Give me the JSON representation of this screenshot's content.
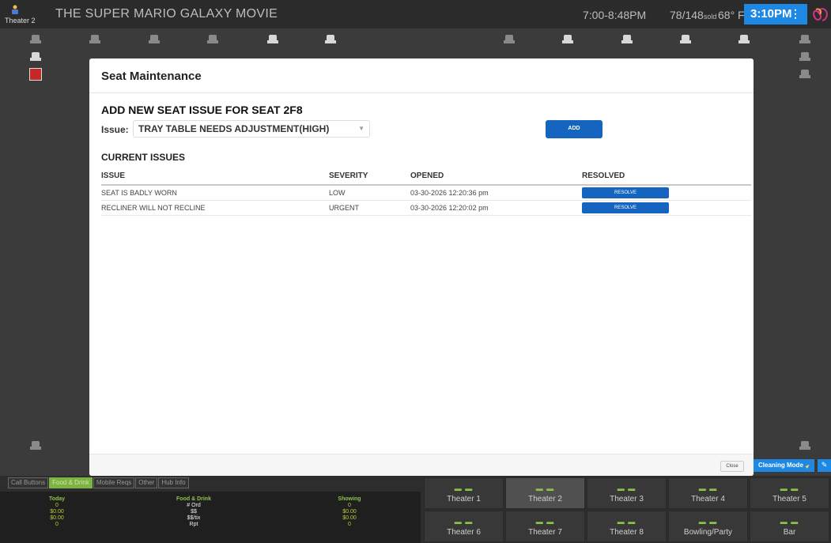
{
  "topbar": {
    "theater_label": "Theater 2",
    "movie_title": "THE SUPER MARIO GALAXY MOVIE",
    "showtime": "7:00-8:48PM",
    "sold_count": "78/148",
    "sold_suffix": "sold",
    "temperature": "68° F",
    "clock": "3:10PM",
    "kebab_icon": "⋮"
  },
  "seatmap": {
    "cleaning_mode_label": "Cleaning Mode",
    "wrench_icon": "✎"
  },
  "modal": {
    "title": "Seat Maintenance",
    "add_title": "ADD NEW SEAT ISSUE FOR SEAT 2F8",
    "issue_label": "Issue:",
    "issue_selected": "TRAY TABLE NEEDS ADJUSTMENT(HIGH)",
    "add_label": "ADD",
    "current_title": "CURRENT ISSUES",
    "columns": [
      "ISSUE",
      "SEVERITY",
      "OPENED",
      "RESOLVED"
    ],
    "issues": [
      {
        "issue": "SEAT IS BADLY WORN",
        "severity": "LOW",
        "opened": "03-30-2026 12:20:36 pm",
        "resolve_label": "RESOLVE"
      },
      {
        "issue": "RECLINER WILL NOT RECLINE",
        "severity": "URGENT",
        "opened": "03-30-2026 12:20:02 pm",
        "resolve_label": "RESOLVE"
      }
    ],
    "close_label": "Close"
  },
  "bottom": {
    "tabs": [
      "Call Buttons",
      "Food & Drink",
      "Mobile Reqs",
      "Other",
      "Hub Info"
    ],
    "stats": {
      "today": {
        "header": "Today",
        "values": [
          "0",
          "$0.00",
          "$0.00",
          "0"
        ]
      },
      "food": {
        "header": "Food & Drink",
        "values": [
          "# Ord",
          "$$",
          "$$/tix",
          "Rpt"
        ]
      },
      "showing": {
        "header": "Showing",
        "values": [
          "0",
          "$0.00",
          "$0.00",
          "0"
        ]
      }
    },
    "theater_dash": "▬ ▬",
    "theaters": [
      "Theater 1",
      "Theater 2",
      "Theater 3",
      "Theater 4",
      "Theater 5",
      "Theater 6",
      "Theater 7",
      "Theater 8",
      "Bowling/Party",
      "Bar"
    ]
  },
  "colors": {
    "accent": "#1e88e5",
    "button": "#1565c0",
    "active_tab": "#7cb342",
    "issue_seat": "#c62828"
  }
}
